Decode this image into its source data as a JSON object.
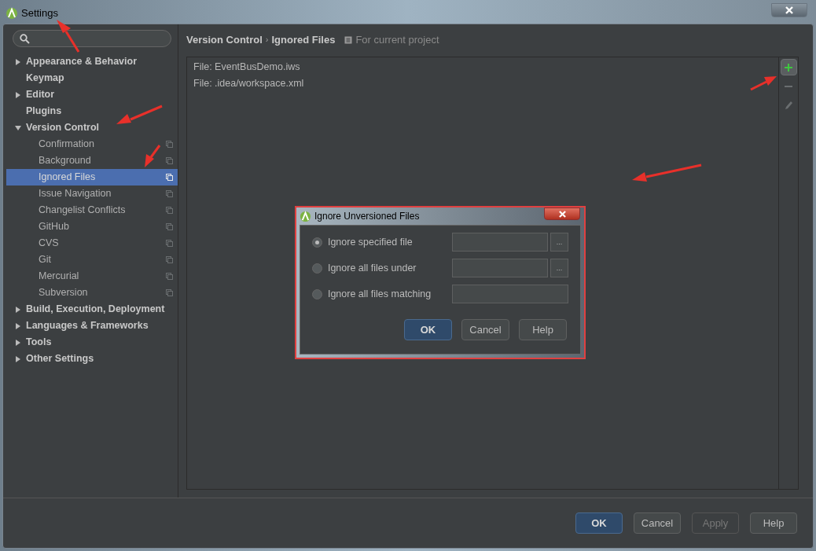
{
  "window": {
    "title": "Settings"
  },
  "sidebar": {
    "items": [
      {
        "label": "Appearance & Behavior",
        "kind": "group",
        "expanded": false,
        "selected": false
      },
      {
        "label": "Keymap",
        "kind": "page",
        "selected": false
      },
      {
        "label": "Editor",
        "kind": "group",
        "expanded": false,
        "selected": false
      },
      {
        "label": "Plugins",
        "kind": "page",
        "selected": false
      },
      {
        "label": "Version Control",
        "kind": "group",
        "expanded": true,
        "selected": false,
        "children": [
          {
            "label": "Confirmation",
            "selected": false
          },
          {
            "label": "Background",
            "selected": false
          },
          {
            "label": "Ignored Files",
            "selected": true
          },
          {
            "label": "Issue Navigation",
            "selected": false
          },
          {
            "label": "Changelist Conflicts",
            "selected": false
          },
          {
            "label": "GitHub",
            "selected": false
          },
          {
            "label": "CVS",
            "selected": false
          },
          {
            "label": "Git",
            "selected": false
          },
          {
            "label": "Mercurial",
            "selected": false
          },
          {
            "label": "Subversion",
            "selected": false
          }
        ]
      },
      {
        "label": "Build, Execution, Deployment",
        "kind": "group",
        "expanded": false,
        "selected": false
      },
      {
        "label": "Languages & Frameworks",
        "kind": "group",
        "expanded": false,
        "selected": false
      },
      {
        "label": "Tools",
        "kind": "group",
        "expanded": false,
        "selected": false
      },
      {
        "label": "Other Settings",
        "kind": "group",
        "expanded": false,
        "selected": false
      }
    ]
  },
  "breadcrumb": {
    "parent": "Version Control",
    "separator": "›",
    "current": "Ignored Files",
    "scope": "For current project"
  },
  "ignored_files": [
    "File: EventBusDemo.iws",
    "File: .idea/workspace.xml"
  ],
  "toolbar": [
    {
      "kind": "add",
      "disabled": false
    },
    {
      "kind": "remove",
      "disabled": true
    },
    {
      "kind": "edit",
      "disabled": true
    }
  ],
  "dialog": {
    "title": "Ignore Unversioned Files",
    "options": [
      {
        "label": "Ignore specified file",
        "selected": true,
        "browse": "..."
      },
      {
        "label": "Ignore all files under",
        "selected": false,
        "browse": "..."
      },
      {
        "label": "Ignore all files matching",
        "selected": false
      }
    ],
    "buttons": [
      {
        "label": "OK",
        "kind": "default"
      },
      {
        "label": "Cancel",
        "kind": "normal"
      },
      {
        "label": "Help",
        "kind": "normal"
      }
    ]
  },
  "buttons": [
    {
      "label": "OK",
      "kind": "default",
      "disabled": false
    },
    {
      "label": "Cancel",
      "kind": "normal",
      "disabled": false
    },
    {
      "label": "Apply",
      "kind": "normal",
      "disabled": true
    },
    {
      "label": "Help",
      "kind": "normal",
      "disabled": false
    }
  ]
}
